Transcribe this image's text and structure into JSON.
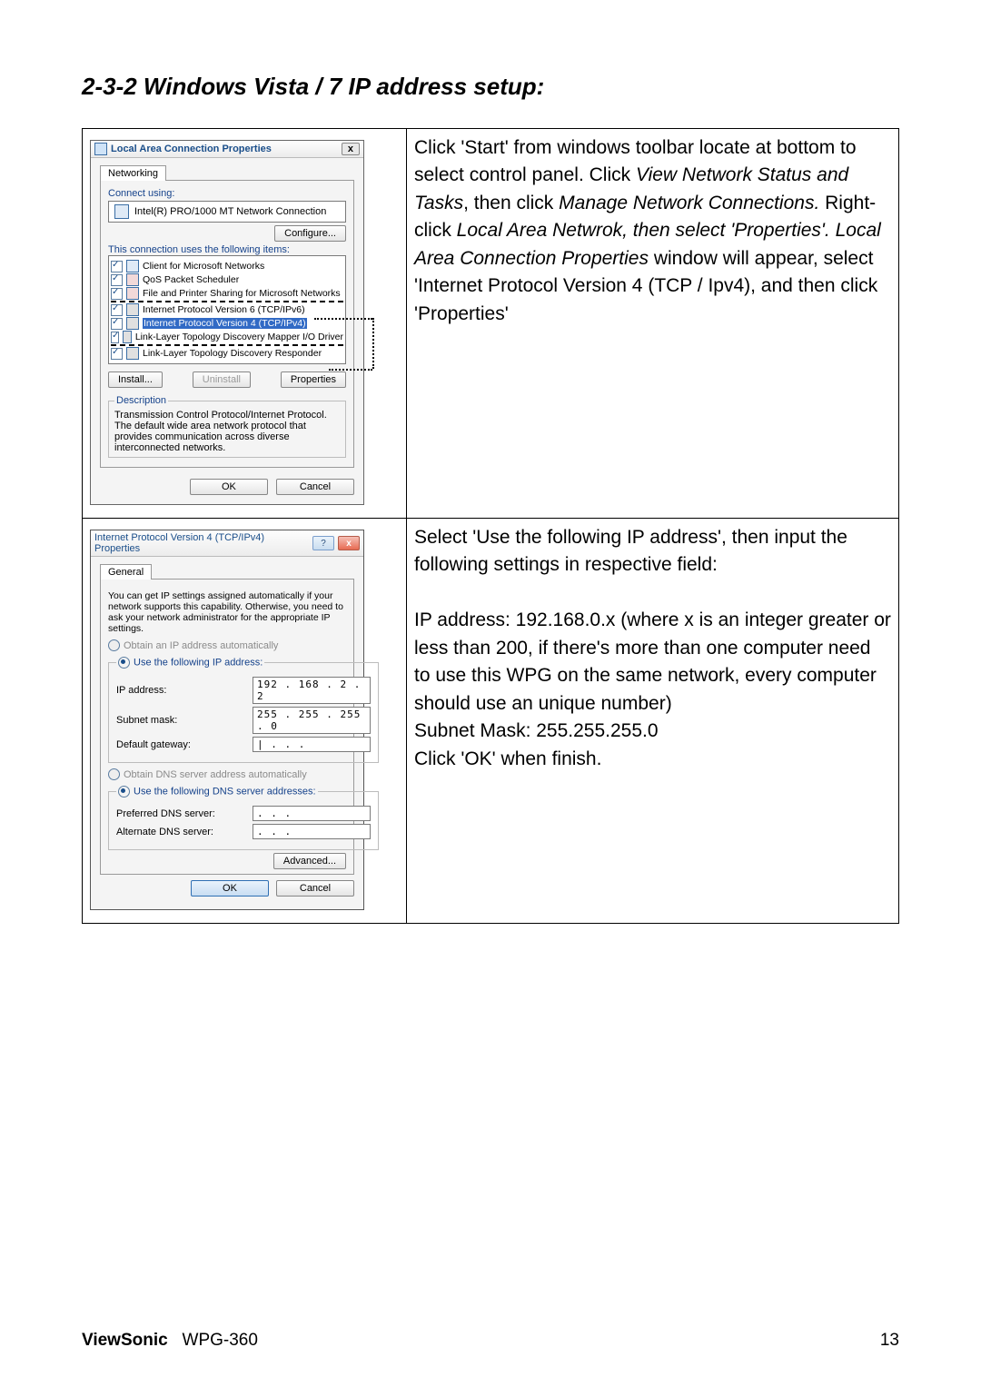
{
  "heading": "2-3-2 Windows Vista / 7 IP address setup:",
  "row1_text": {
    "p1a": "Click 'Start' from windows toolbar locate at bottom to select control panel. Click ",
    "p1b_i": "View Network Status and Tasks",
    "p1c": ", then click ",
    "p1d_i": "Manage Network Connections.",
    "p1e": " Right-click ",
    "p1f_i": "Local Area Netwrok, then select 'Properties'. Local Area Connection Properties",
    "p1g": " window will appear, select 'Internet Protocol Version 4 (TCP / Ipv4), and then click 'Properties'"
  },
  "row2_text": {
    "l1": "Select 'Use the following IP address', then input the following settings in respective field:",
    "l2": "IP address: 192.168.0.x (where x is an integer greater or less than 200, if there's more than one computer need to use this WPG on the same network, every computer should use an unique number)",
    "l3": "Subnet Mask: 255.255.255.0",
    "l4": "Click 'OK' when finish."
  },
  "dlg1": {
    "title": "Local Area Connection Properties",
    "tab": "Networking",
    "connect_using_label": "Connect using:",
    "adapter": "Intel(R) PRO/1000 MT Network Connection",
    "configure": "Configure...",
    "uses_label": "This connection uses the following items:",
    "items": {
      "i0": "Client for Microsoft Networks",
      "i1": "QoS Packet Scheduler",
      "i2": "File and Printer Sharing for Microsoft Networks",
      "i3": "Internet Protocol Version 6 (TCP/IPv6)",
      "i4": "Internet Protocol Version 4 (TCP/IPv4)",
      "i5": "Link-Layer Topology Discovery Mapper I/O Driver",
      "i6": "Link-Layer Topology Discovery Responder"
    },
    "install": "Install...",
    "uninstall": "Uninstall",
    "properties": "Properties",
    "desc_legend": "Description",
    "desc_text": "Transmission Control Protocol/Internet Protocol. The default wide area network protocol that provides communication across diverse interconnected networks.",
    "ok": "OK",
    "cancel": "Cancel",
    "close_x": "x"
  },
  "dlg2": {
    "title": "Internet Protocol Version 4 (TCP/IPv4) Properties",
    "help_q": "?",
    "close_x": "x",
    "tab": "General",
    "note": "You can get IP settings assigned automatically if your network supports this capability. Otherwise, you need to ask your network administrator for the appropriate IP settings.",
    "r_obtain_ip": "Obtain an IP address automatically",
    "r_use_ip": "Use the following IP address:",
    "ip_label": "IP address:",
    "ip_val": "192 . 168 .  2  .  2",
    "mask_label": "Subnet mask:",
    "mask_val": "255 . 255 . 255 .  0",
    "gw_label": "Default gateway:",
    "gw_val": "|   .       .       .",
    "r_obtain_dns": "Obtain DNS server address automatically",
    "r_use_dns": "Use the following DNS server addresses:",
    "pdns_label": "Preferred DNS server:",
    "pdns_val": "    .       .       .",
    "adns_label": "Alternate DNS server:",
    "adns_val": "    .       .       .",
    "advanced": "Advanced...",
    "ok": "OK",
    "cancel": "Cancel"
  },
  "footer": {
    "brand": "ViewSonic",
    "model": "WPG-360",
    "page": "13"
  }
}
